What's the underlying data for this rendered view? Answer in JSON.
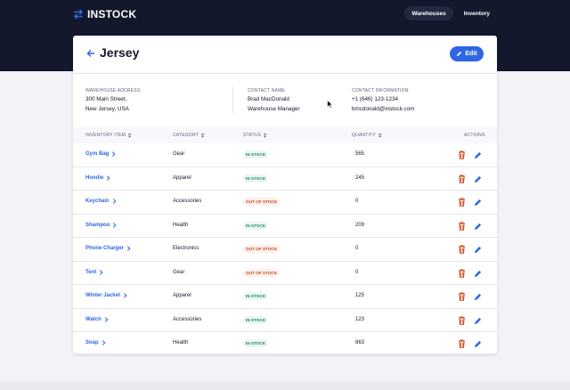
{
  "app": {
    "logo": "INSTOCK"
  },
  "nav": {
    "items": [
      {
        "label": "Warehouses",
        "active": true
      },
      {
        "label": "Inventory",
        "active": false
      }
    ]
  },
  "warehouse": {
    "title": "Jersey",
    "edit_label": "Edit",
    "address_label": "WAREHOUSE ADDRESS:",
    "address_line1": "300 Main Street,",
    "address_line2": "New Jersey, USA",
    "contact_name_label": "CONTACT NAME:",
    "contact_name": "Brad MacDonald",
    "contact_title": "Warehouse Manager",
    "contact_info_label": "CONTACT INFORMATION:",
    "phone": "+1 (646) 123-1234",
    "email": "bmcdonald@instock.com"
  },
  "table": {
    "headers": {
      "item": "INVENTORY ITEM",
      "category": "CATEGORY",
      "status": "STATUS",
      "quantity": "QUANTITY",
      "actions": "ACTIONS"
    },
    "rows": [
      {
        "item": "Gym Bag",
        "category": "Gear",
        "status": "IN STOCK",
        "in_stock": true,
        "quantity": "565"
      },
      {
        "item": "Hoodie",
        "category": "Apparel",
        "status": "IN STOCK",
        "in_stock": true,
        "quantity": "245"
      },
      {
        "item": "Keychain",
        "category": "Accessories",
        "status": "OUT OF STOCK",
        "in_stock": false,
        "quantity": "0"
      },
      {
        "item": "Shampoo",
        "category": "Health",
        "status": "IN STOCK",
        "in_stock": true,
        "quantity": "209"
      },
      {
        "item": "Phone Charger",
        "category": "Electronics",
        "status": "OUT OF STOCK",
        "in_stock": false,
        "quantity": "0"
      },
      {
        "item": "Tent",
        "category": "Gear",
        "status": "OUT OF STOCK",
        "in_stock": false,
        "quantity": "0"
      },
      {
        "item": "Winter Jacket",
        "category": "Apparel",
        "status": "IN STOCK",
        "in_stock": true,
        "quantity": "125"
      },
      {
        "item": "Watch",
        "category": "Accessories",
        "status": "IN STOCK",
        "in_stock": true,
        "quantity": "123"
      },
      {
        "item": "Soap",
        "category": "Health",
        "status": "IN STOCK",
        "in_stock": true,
        "quantity": "863"
      }
    ]
  },
  "colors": {
    "header_bg": "#13182c",
    "accent": "#2e66e6",
    "in_stock": "#158463",
    "out_of_stock": "#c94515",
    "delete": "#c94515"
  },
  "icons": {
    "logo": "swap-arrows-icon",
    "back": "arrow-left-icon",
    "edit": "pencil-icon",
    "sort": "sort-icon",
    "chevron": "chevron-right-icon",
    "delete": "trash-icon"
  }
}
